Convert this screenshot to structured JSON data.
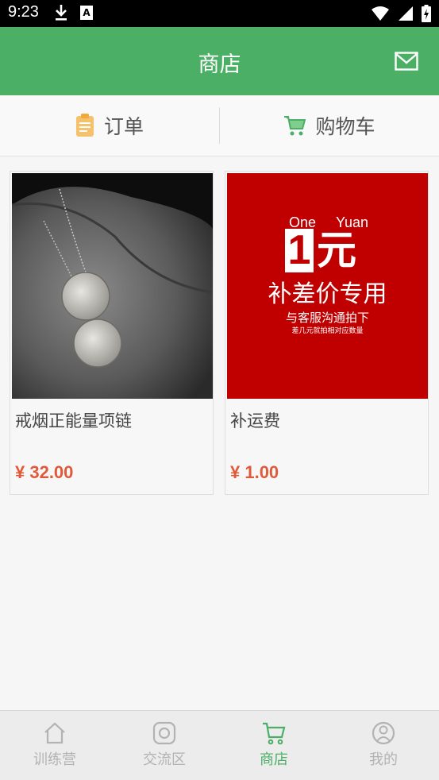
{
  "status_bar": {
    "time": "9:23",
    "left_icons": [
      "download-icon",
      "keyboard-a-icon"
    ],
    "right_icons": [
      "wifi-icon",
      "signal-icon",
      "battery-charging-icon"
    ]
  },
  "header": {
    "title": "商店",
    "action_icon": "mail-icon",
    "background_color": "#4caf66"
  },
  "tabs": [
    {
      "label": "订单",
      "icon": "clipboard-icon",
      "icon_color": "#f5c16c"
    },
    {
      "label": "购物车",
      "icon": "cart-icon",
      "icon_color": "#4caf66"
    }
  ],
  "products": [
    {
      "title": "戒烟正能量项链",
      "price": "¥ 32.00",
      "image": "necklace-photo"
    },
    {
      "title": "补运费",
      "price": "¥ 1.00",
      "image": "promo-banner",
      "promo": {
        "one": "One",
        "yuan": "Yuan",
        "digit": "1",
        "currency_cn": "元",
        "main": "补差价专用",
        "sub": "与客服沟通拍下",
        "small": "差几元就拍相对应数量"
      }
    }
  ],
  "bottom_nav": {
    "active_color": "#4caf66",
    "inactive_color": "#b3b3b3",
    "items": [
      {
        "label": "训练营",
        "icon": "home-icon",
        "active": false
      },
      {
        "label": "交流区",
        "icon": "instagram-icon",
        "active": false
      },
      {
        "label": "商店",
        "icon": "cart-icon",
        "active": true
      },
      {
        "label": "我的",
        "icon": "profile-icon",
        "active": false
      }
    ]
  }
}
